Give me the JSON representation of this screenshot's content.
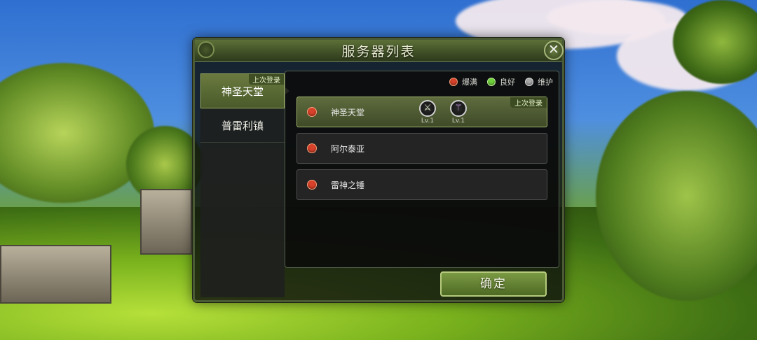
{
  "dialog": {
    "title": "服务器列表",
    "close_label": "✕",
    "confirm_label": "确定"
  },
  "legend": [
    {
      "label": "爆满",
      "color": "#d8412a"
    },
    {
      "label": "良好",
      "color": "#6fd13a"
    },
    {
      "label": "维护",
      "color": "#a8a8a8"
    }
  ],
  "regions": [
    {
      "label": "神圣天堂",
      "tag": "上次登录",
      "active": true
    },
    {
      "label": "普雷利镇",
      "active": false
    }
  ],
  "servers": [
    {
      "name": "神圣天堂",
      "status": "爆满",
      "status_color": "#d8412a",
      "selected": true,
      "tag": "上次登录",
      "badges": [
        {
          "icon": "crossed-swords-icon",
          "glyph": "⚔",
          "level": "Lv.1"
        },
        {
          "icon": "wand-icon",
          "glyph": "⚚",
          "level": "Lv.1"
        }
      ]
    },
    {
      "name": "阿尔泰亚",
      "status": "爆满",
      "status_color": "#d8412a",
      "selected": false
    },
    {
      "name": "雷神之锤",
      "status": "爆满",
      "status_color": "#d8412a",
      "selected": false
    }
  ]
}
